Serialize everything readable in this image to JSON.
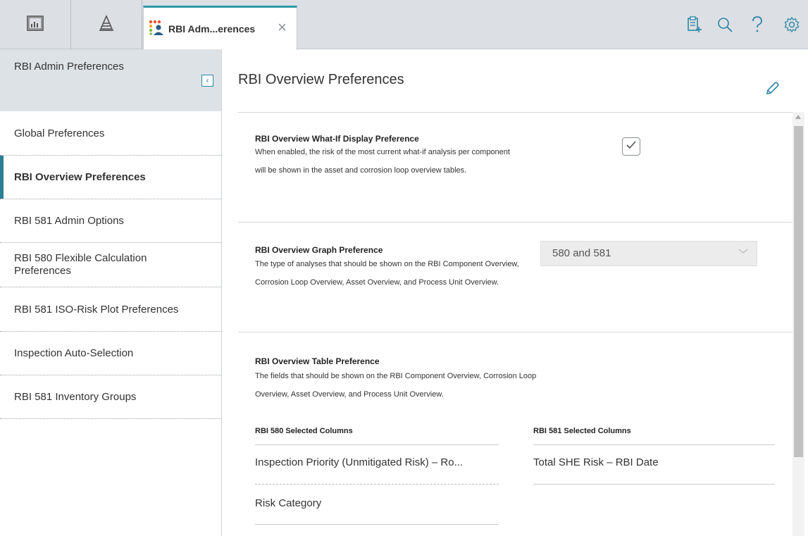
{
  "tabs": {
    "active_tab_title": "RBI Adm...erences",
    "close_glyph": "×"
  },
  "top_actions": [
    "notes-icon",
    "search-icon",
    "help-icon",
    "settings-icon"
  ],
  "sidebar": {
    "title": "RBI Admin Preferences",
    "collapse_glyph": "‹",
    "items": [
      {
        "label": "Global Preferences",
        "active": false
      },
      {
        "label": "RBI Overview Preferences",
        "active": true
      },
      {
        "label": "RBI 581 Admin Options",
        "active": false
      },
      {
        "label": "RBI 580 Flexible Calculation Preferences",
        "active": false
      },
      {
        "label": "RBI 581 ISO-Risk Plot Preferences",
        "active": false
      },
      {
        "label": "Inspection Auto-Selection",
        "active": false
      },
      {
        "label": "RBI 581 Inventory Groups",
        "active": false
      }
    ]
  },
  "main": {
    "title": "RBI Overview Preferences",
    "whatif": {
      "label": "RBI Overview What-If Display Preference",
      "description": "When enabled, the risk of the most current what-if analysis per component will be shown in the asset and corrosion loop overview tables.",
      "checked": true
    },
    "graph": {
      "label": "RBI Overview Graph Preference",
      "description": "The type of analyses that should be shown on the RBI Component Overview, Corrosion Loop Overview, Asset Overview, and Process Unit Overview.",
      "selected": "580 and 581"
    },
    "table": {
      "label": "RBI Overview Table Preference",
      "description": "The fields that should be shown on the RBI Component Overview, Corrosion Loop Overview, Asset Overview, and Process Unit Overview.",
      "col580_header": "RBI 580 Selected Columns",
      "col580_items": [
        "Inspection Priority (Unmitigated Risk) – Ro...",
        "Risk Category"
      ],
      "col581_header": "RBI 581 Selected Columns",
      "col581_items": [
        "Total SHE Risk – RBI Date"
      ]
    }
  },
  "colors": {
    "accent": "#2e9aa8",
    "active_nav_bar": "#2b7f92",
    "link_blue": "#2e86a8"
  }
}
